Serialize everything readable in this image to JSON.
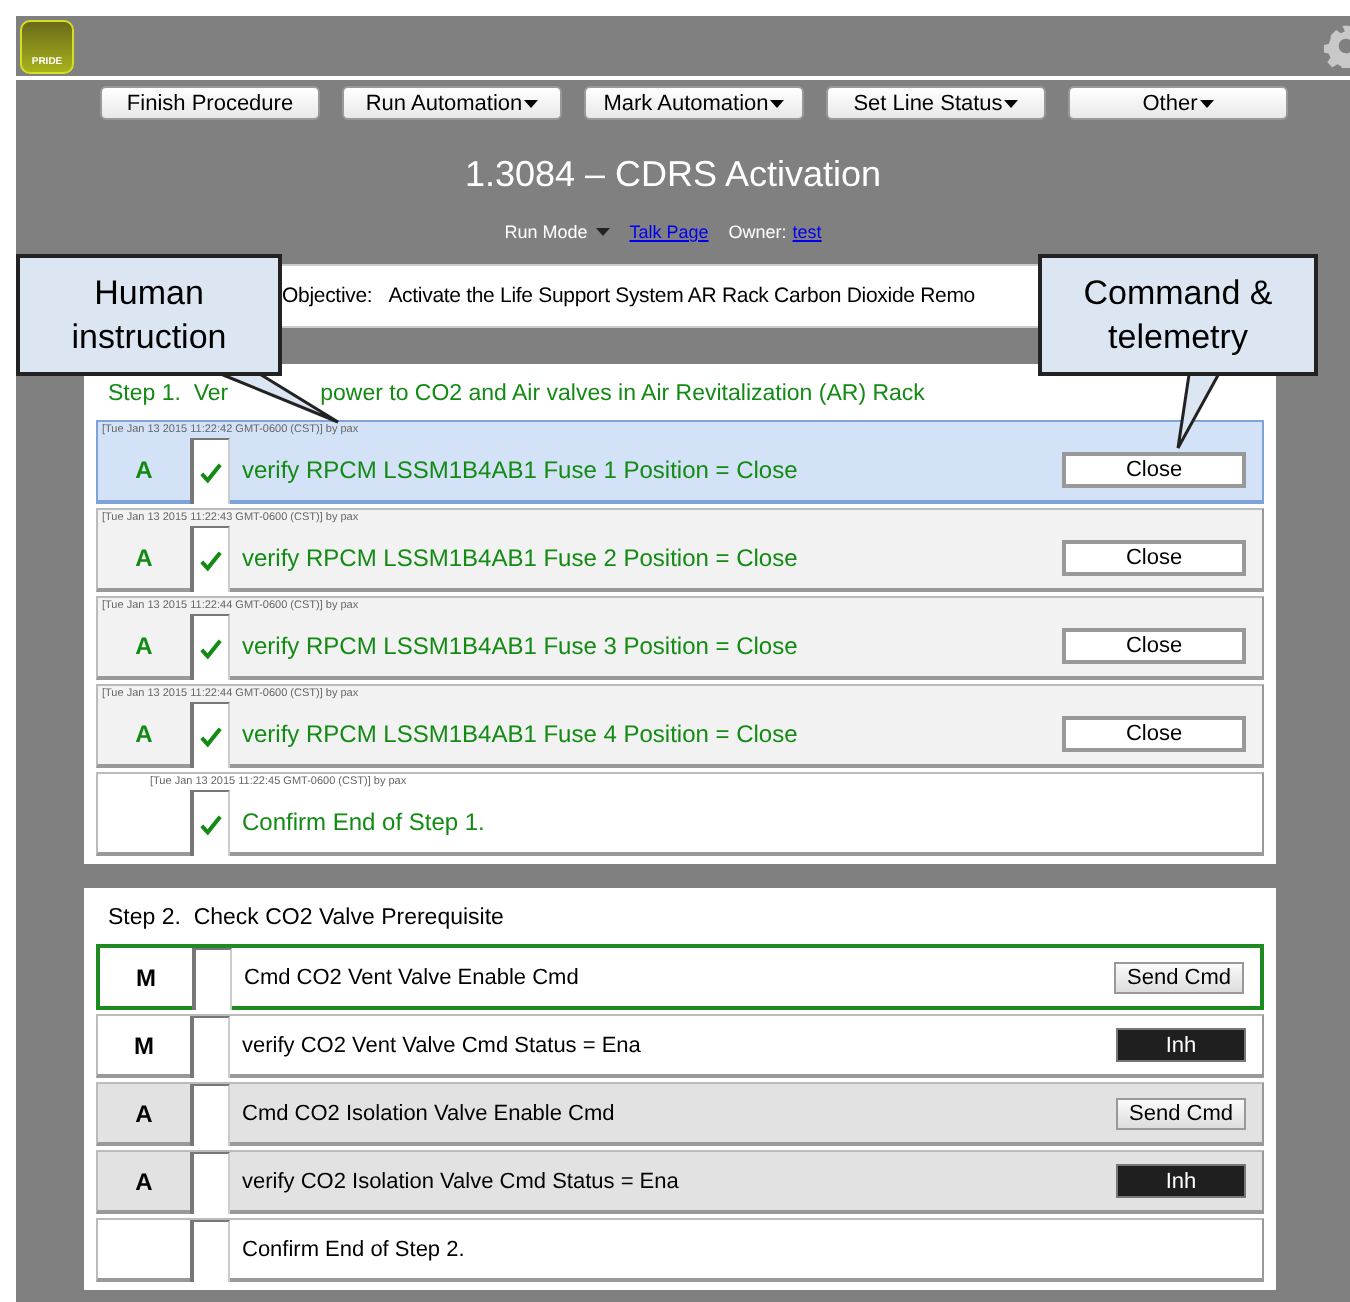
{
  "header": {
    "logo_text": "PRIDE"
  },
  "toolbar": [
    {
      "label": "Finish Procedure",
      "dropdown": false
    },
    {
      "label": "Run Automation",
      "dropdown": true
    },
    {
      "label": "Mark Automation",
      "dropdown": true
    },
    {
      "label": "Set Line Status",
      "dropdown": true
    },
    {
      "label": "Other",
      "dropdown": true
    }
  ],
  "title": "1.3084 – CDRS Activation",
  "meta": {
    "run_mode": "Run Mode",
    "talk_link": "Talk Page",
    "owner_label": "Owner:",
    "owner_link": "test"
  },
  "objective": {
    "label": "Objective:",
    "text": "Activate the Life Support System AR Rack Carbon Dioxide Remo"
  },
  "callouts": [
    {
      "text": "Human instruction"
    },
    {
      "text": "Command & telemetry"
    }
  ],
  "steps": [
    {
      "title_parts": [
        "Step 1.  Ver",
        "power to CO2 and Air valves in Air Revitalization (AR) Rack"
      ],
      "completed": true,
      "rows": [
        {
          "timestamp": "[Tue Jan 13 2015 11:22:42 GMT-0600 (CST)] by pax",
          "mode": "A",
          "checked": true,
          "text": "verify RPCM LSSM1B4AB1 Fuse 1 Position = Close",
          "button": {
            "label": "Close",
            "kind": "value"
          },
          "selected": true,
          "current": false,
          "shaded": true
        },
        {
          "timestamp": "[Tue Jan 13 2015 11:22:43 GMT-0600 (CST)] by pax",
          "mode": "A",
          "checked": true,
          "text": "verify RPCM LSSM1B4AB1 Fuse 2 Position = Close",
          "button": {
            "label": "Close",
            "kind": "value"
          },
          "selected": false,
          "current": false,
          "shaded": true
        },
        {
          "timestamp": "[Tue Jan 13 2015 11:22:44 GMT-0600 (CST)] by pax",
          "mode": "A",
          "checked": true,
          "text": "verify RPCM LSSM1B4AB1 Fuse 3 Position = Close",
          "button": {
            "label": "Close",
            "kind": "value"
          },
          "selected": false,
          "current": false,
          "shaded": true
        },
        {
          "timestamp": "[Tue Jan 13 2015 11:22:44 GMT-0600 (CST)] by pax",
          "mode": "A",
          "checked": true,
          "text": "verify RPCM LSSM1B4AB1 Fuse 4 Position = Close",
          "button": {
            "label": "Close",
            "kind": "value"
          },
          "selected": false,
          "current": false,
          "shaded": true
        },
        {
          "timestamp": "[Tue Jan 13 2015 11:22:45 GMT-0600 (CST)] by pax",
          "checked": true,
          "text": "Confirm End of Step 1.",
          "selected": false,
          "current": false
        }
      ]
    },
    {
      "title_parts": [
        "Step 2.  Check CO2 Valve Prerequisite"
      ],
      "completed": false,
      "rows": [
        {
          "mode": "M",
          "checked": false,
          "text": "Cmd CO2 Vent Valve Enable Cmd",
          "button": {
            "label": "Send Cmd",
            "kind": "command"
          },
          "selected": false,
          "current": true,
          "shaded": false
        },
        {
          "mode": "M",
          "checked": false,
          "text": "verify CO2 Vent Valve Cmd Status = Ena",
          "button": {
            "label": "Inh",
            "kind": "status"
          },
          "selected": false,
          "current": false,
          "shaded": false
        },
        {
          "mode": "A",
          "checked": false,
          "text": "Cmd CO2 Isolation Valve Enable Cmd",
          "button": {
            "label": "Send Cmd",
            "kind": "command"
          },
          "selected": false,
          "current": false,
          "shaded": true
        },
        {
          "mode": "A",
          "checked": false,
          "text": "verify CO2 Isolation Valve Cmd Status = Ena",
          "button": {
            "label": "Inh",
            "kind": "status"
          },
          "selected": false,
          "current": false,
          "shaded": true
        },
        {
          "checked": false,
          "text": "Confirm End of Step 2.",
          "selected": false,
          "current": false
        }
      ]
    }
  ]
}
